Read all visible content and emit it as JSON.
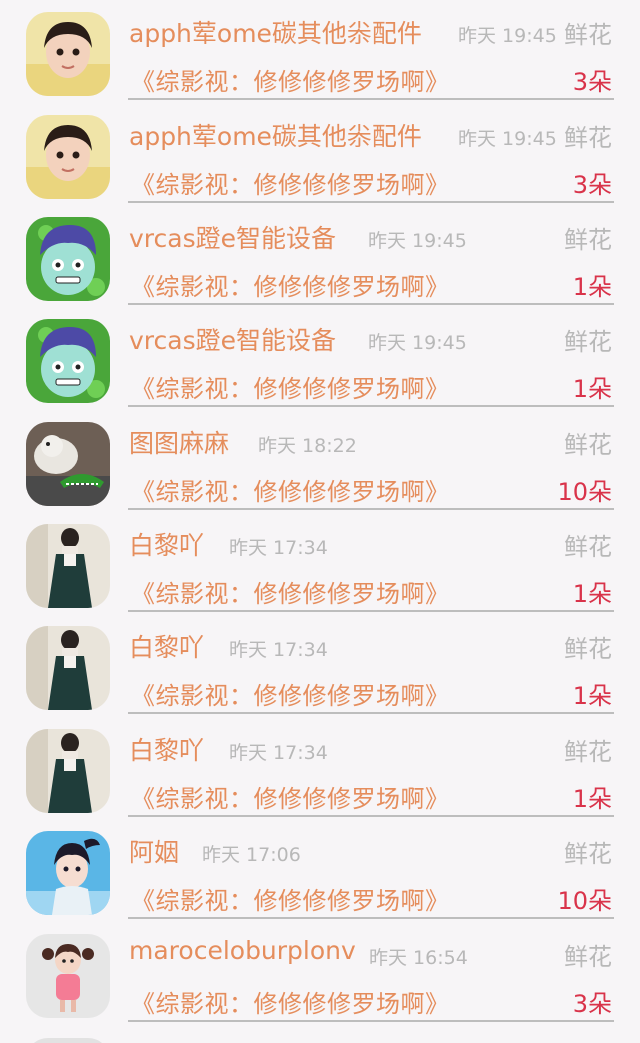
{
  "rows": [
    {
      "name": "apph荤ome碳其他尜配件",
      "time": "昨天 19:45",
      "gift_label": "鲜花",
      "message": "《综影视：修修修修罗场啊》",
      "count": "3朵",
      "avatar_icon": "girl-portrait-avatar"
    },
    {
      "name": "apph荤ome碳其他尜配件",
      "time": "昨天 19:45",
      "gift_label": "鲜花",
      "message": "《综影视：修修修修罗场啊》",
      "count": "3朵",
      "avatar_icon": "girl-portrait-avatar"
    },
    {
      "name": "vrcas蹬e智能设备",
      "time": "昨天 19:45",
      "gift_label": "鲜花",
      "message": "《综影视：修修修修罗场啊》",
      "count": "1朵",
      "avatar_icon": "cartoon-zombie-avatar"
    },
    {
      "name": "vrcas蹬e智能设备",
      "time": "昨天 19:45",
      "gift_label": "鲜花",
      "message": "《综影视：修修修修罗场啊》",
      "count": "1朵",
      "avatar_icon": "cartoon-zombie-avatar"
    },
    {
      "name": "图图麻麻",
      "time": "昨天 18:22",
      "gift_label": "鲜花",
      "message": "《综影视：修修修修罗场啊》",
      "count": "10朵",
      "avatar_icon": "dog-and-crocodile-toy-avatar"
    },
    {
      "name": "白黎吖",
      "time": "昨天 17:34",
      "gift_label": "鲜花",
      "message": "《综影视：修修修修罗场啊》",
      "count": "1朵",
      "avatar_icon": "girl-in-dress-avatar"
    },
    {
      "name": "白黎吖",
      "time": "昨天 17:34",
      "gift_label": "鲜花",
      "message": "《综影视：修修修修罗场啊》",
      "count": "1朵",
      "avatar_icon": "girl-in-dress-avatar"
    },
    {
      "name": "白黎吖",
      "time": "昨天 17:34",
      "gift_label": "鲜花",
      "message": "《综影视：修修修修罗场啊》",
      "count": "1朵",
      "avatar_icon": "girl-in-dress-avatar"
    },
    {
      "name": "阿姻",
      "time": "昨天 17:06",
      "gift_label": "鲜花",
      "message": "《综影视：修修修修罗场啊》",
      "count": "10朵",
      "avatar_icon": "costume-girl-avatar"
    },
    {
      "name": "maroceloburplonv",
      "time": "昨天 16:54",
      "gift_label": "鲜花",
      "message": "《综影视：修修修修罗场啊》",
      "count": "3朵",
      "avatar_icon": "cartoon-girl-avatar"
    }
  ],
  "colors": {
    "name": "#e58d5c",
    "message": "#e58d5c",
    "count": "#d9334a",
    "muted": "#b8b8b8",
    "background": "#f7f5f7"
  }
}
